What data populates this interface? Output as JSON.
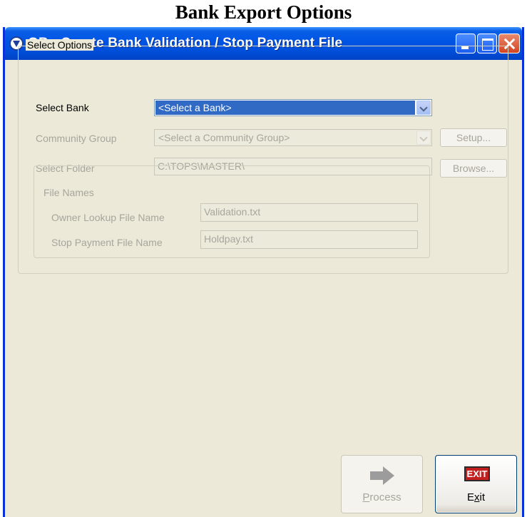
{
  "heading": "Bank Export Options",
  "window": {
    "title": "GB - Create Bank Validation / Stop Payment File",
    "app_icon": "gb-app-icon",
    "controls": [
      "minimize-icon",
      "maximize-icon",
      "close-icon"
    ]
  },
  "select_options": {
    "legend": "Select Options",
    "bank": {
      "label": "Select Bank",
      "value": "<Select a Bank>",
      "enabled": true
    },
    "community_group": {
      "label": "Community Group",
      "value": "<Select a Community Group>",
      "enabled": false
    },
    "folder": {
      "label": "Select Folder",
      "value": "C:\\TOPS\\MASTER\\",
      "enabled": false
    },
    "setup_label": "Setup...",
    "browse_label": "Browse..."
  },
  "file_names": {
    "legend": "File Names",
    "owner_lookup": {
      "label": "Owner Lookup File Name",
      "value": "Validation.txt"
    },
    "stop_payment": {
      "label": "Stop Payment File Name",
      "value": "Holdpay.txt"
    }
  },
  "buttons": {
    "process": {
      "accel": "P",
      "rest": "rocess",
      "enabled": false,
      "icon": "right-arrow-icon"
    },
    "exit": {
      "pre": "E",
      "accel": "x",
      "rest": "it",
      "icon_text": "EXIT",
      "icon": "exit-sign-icon"
    }
  },
  "colors": {
    "titlebar": "#0055e5",
    "window_bg": "#ece9d8",
    "selection": "#316ac5",
    "disabled_text": "#a7a69c"
  }
}
